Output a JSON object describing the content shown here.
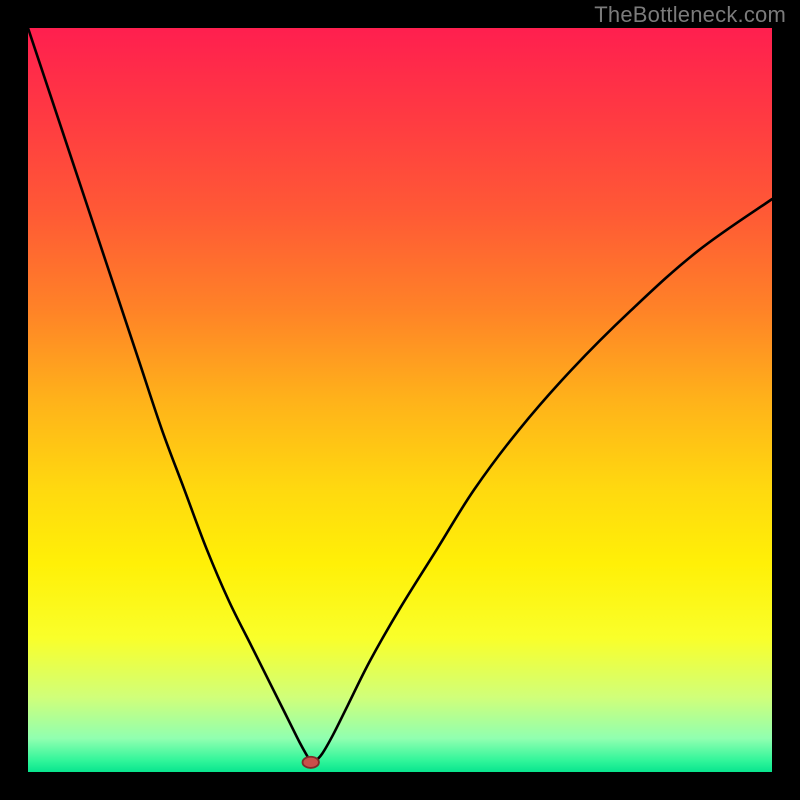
{
  "watermark": "TheBottleneck.com",
  "chart_data": {
    "type": "line",
    "title": "",
    "xlabel": "",
    "ylabel": "",
    "xlim": [
      0,
      100
    ],
    "ylim": [
      0,
      100
    ],
    "grid": false,
    "legend": false,
    "background": {
      "type": "vertical-gradient",
      "stops": [
        {
          "offset": 0.0,
          "color": "#ff1f4f"
        },
        {
          "offset": 0.12,
          "color": "#ff3a42"
        },
        {
          "offset": 0.25,
          "color": "#ff5a35"
        },
        {
          "offset": 0.38,
          "color": "#ff8327"
        },
        {
          "offset": 0.5,
          "color": "#ffb21a"
        },
        {
          "offset": 0.62,
          "color": "#ffd90f"
        },
        {
          "offset": 0.72,
          "color": "#fff007"
        },
        {
          "offset": 0.82,
          "color": "#f9ff2a"
        },
        {
          "offset": 0.9,
          "color": "#d0ff7a"
        },
        {
          "offset": 0.955,
          "color": "#90ffb0"
        },
        {
          "offset": 0.985,
          "color": "#30f59a"
        },
        {
          "offset": 1.0,
          "color": "#08e58e"
        }
      ]
    },
    "series": [
      {
        "name": "bottleneck-curve",
        "color": "#000000",
        "x": [
          0,
          3,
          6,
          9,
          12,
          15,
          18,
          21,
          24,
          27,
          30,
          33,
          35,
          36.5,
          37.5,
          38.0,
          38.5,
          39.5,
          41,
          43,
          46,
          50,
          55,
          60,
          66,
          73,
          81,
          90,
          100
        ],
        "y": [
          100,
          91,
          82,
          73,
          64,
          55,
          46,
          38,
          30,
          23,
          17,
          11,
          7,
          4,
          2.2,
          1.4,
          1.4,
          2.4,
          5,
          9,
          15,
          22,
          30,
          38,
          46,
          54,
          62,
          70,
          77
        ]
      }
    ],
    "markers": [
      {
        "name": "minimum-point",
        "x": 38,
        "y": 1.3,
        "rx": 1.1,
        "ry": 0.75,
        "fill": "#c94f4a",
        "stroke": "#7e2e2a"
      }
    ]
  }
}
